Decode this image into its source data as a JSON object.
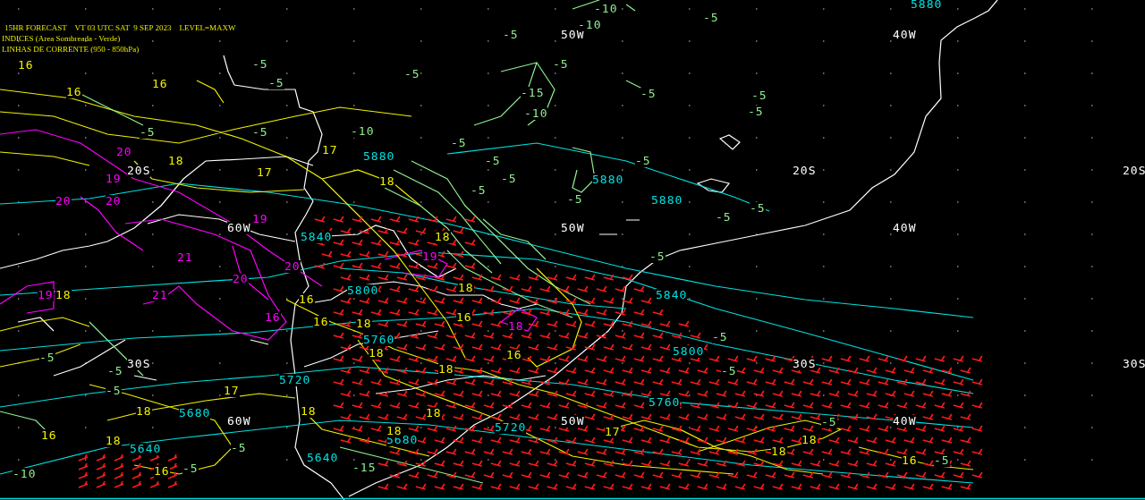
{
  "header": {
    "lines": [
      "15HR FORECAST    VT 03 UTC SAT  9 SEP 2023    LEVEL=MAXW",
      "INDICES (Area Sombreada - Verde)",
      "LINHAS DE CORRENTE (950 - 850hPa)"
    ]
  },
  "map": {
    "labels": [
      {
        "text": "50W",
        "kind": "grid"
      },
      {
        "text": "40W",
        "kind": "grid"
      },
      {
        "text": "20S",
        "kind": "grid"
      },
      {
        "text": "20S",
        "kind": "grid"
      },
      {
        "text": "20S",
        "kind": "grid"
      },
      {
        "text": "60W",
        "kind": "grid"
      },
      {
        "text": "50W",
        "kind": "grid"
      },
      {
        "text": "40W",
        "kind": "grid"
      },
      {
        "text": "30S",
        "kind": "grid"
      },
      {
        "text": "30S",
        "kind": "grid"
      },
      {
        "text": "30S",
        "kind": "grid"
      },
      {
        "text": "60W",
        "kind": "grid"
      },
      {
        "text": "50W",
        "kind": "grid"
      },
      {
        "text": "40W",
        "kind": "grid"
      },
      {
        "text": "5880",
        "kind": "height"
      },
      {
        "text": "5880",
        "kind": "height"
      },
      {
        "text": "5880",
        "kind": "height"
      },
      {
        "text": "5880",
        "kind": "height"
      },
      {
        "text": "5840",
        "kind": "height"
      },
      {
        "text": "5840",
        "kind": "height"
      },
      {
        "text": "5800",
        "kind": "height"
      },
      {
        "text": "5800",
        "kind": "height"
      },
      {
        "text": "5760",
        "kind": "height"
      },
      {
        "text": "5760",
        "kind": "height"
      },
      {
        "text": "5720",
        "kind": "height"
      },
      {
        "text": "5720",
        "kind": "height"
      },
      {
        "text": "5680",
        "kind": "height"
      },
      {
        "text": "5680",
        "kind": "height"
      },
      {
        "text": "5640",
        "kind": "height"
      },
      {
        "text": "5640",
        "kind": "height"
      },
      {
        "text": "20",
        "kind": "index"
      },
      {
        "text": "19",
        "kind": "index"
      },
      {
        "text": "19",
        "kind": "index"
      },
      {
        "text": "20",
        "kind": "index"
      },
      {
        "text": "20",
        "kind": "index"
      },
      {
        "text": "21",
        "kind": "index"
      },
      {
        "text": "20",
        "kind": "index"
      },
      {
        "text": "21",
        "kind": "index"
      },
      {
        "text": "20",
        "kind": "index"
      },
      {
        "text": "19",
        "kind": "index"
      },
      {
        "text": "16",
        "kind": "index"
      },
      {
        "text": "18",
        "kind": "index"
      },
      {
        "text": "19",
        "kind": "index"
      },
      {
        "text": "16",
        "kind": "temp"
      },
      {
        "text": "16",
        "kind": "temp"
      },
      {
        "text": "16",
        "kind": "temp"
      },
      {
        "text": "18",
        "kind": "temp"
      },
      {
        "text": "17",
        "kind": "temp"
      },
      {
        "text": "17",
        "kind": "temp"
      },
      {
        "text": "18",
        "kind": "temp"
      },
      {
        "text": "18",
        "kind": "temp"
      },
      {
        "text": "18",
        "kind": "temp"
      },
      {
        "text": "16",
        "kind": "temp"
      },
      {
        "text": "16",
        "kind": "temp"
      },
      {
        "text": "18",
        "kind": "temp"
      },
      {
        "text": "18",
        "kind": "temp"
      },
      {
        "text": "18",
        "kind": "temp"
      },
      {
        "text": "16",
        "kind": "temp"
      },
      {
        "text": "18",
        "kind": "temp"
      },
      {
        "text": "16",
        "kind": "temp"
      },
      {
        "text": "17",
        "kind": "temp"
      },
      {
        "text": "18",
        "kind": "temp"
      },
      {
        "text": "18",
        "kind": "temp"
      },
      {
        "text": "16",
        "kind": "temp"
      },
      {
        "text": "16",
        "kind": "temp"
      },
      {
        "text": "18",
        "kind": "temp"
      },
      {
        "text": "18",
        "kind": "temp"
      },
      {
        "text": "17",
        "kind": "temp"
      },
      {
        "text": "18",
        "kind": "temp"
      },
      {
        "text": "18",
        "kind": "temp"
      },
      {
        "text": "16",
        "kind": "temp"
      },
      {
        "text": "18",
        "kind": "temp"
      },
      {
        "text": "-5",
        "kind": "lifted"
      },
      {
        "text": "-5",
        "kind": "lifted"
      },
      {
        "text": "-5",
        "kind": "lifted"
      },
      {
        "text": "-5",
        "kind": "lifted"
      },
      {
        "text": "-5",
        "kind": "lifted"
      },
      {
        "text": "-5",
        "kind": "lifted"
      },
      {
        "text": "-5",
        "kind": "lifted"
      },
      {
        "text": "-5",
        "kind": "lifted"
      },
      {
        "text": "-5",
        "kind": "lifted"
      },
      {
        "text": "-5",
        "kind": "lifted"
      },
      {
        "text": "-5",
        "kind": "lifted"
      },
      {
        "text": "-5",
        "kind": "lifted"
      },
      {
        "text": "-5",
        "kind": "lifted"
      },
      {
        "text": "-5",
        "kind": "lifted"
      },
      {
        "text": "-5",
        "kind": "lifted"
      },
      {
        "text": "-5",
        "kind": "lifted"
      },
      {
        "text": "-5",
        "kind": "lifted"
      },
      {
        "text": "-5",
        "kind": "lifted"
      },
      {
        "text": "-5",
        "kind": "lifted"
      },
      {
        "text": "-5",
        "kind": "lifted"
      },
      {
        "text": "-5",
        "kind": "lifted"
      },
      {
        "text": "-5",
        "kind": "lifted"
      },
      {
        "text": "-5",
        "kind": "lifted"
      },
      {
        "text": "-5",
        "kind": "lifted"
      },
      {
        "text": "-5",
        "kind": "lifted"
      },
      {
        "text": "-5",
        "kind": "lifted"
      },
      {
        "text": "-5",
        "kind": "lifted"
      },
      {
        "text": "-5",
        "kind": "lifted"
      },
      {
        "text": "-5",
        "kind": "lifted"
      },
      {
        "text": "-10",
        "kind": "lifted"
      },
      {
        "text": "-10",
        "kind": "lifted"
      },
      {
        "text": "-10",
        "kind": "lifted"
      },
      {
        "text": "-15",
        "kind": "lifted"
      },
      {
        "text": "-10",
        "kind": "lifted"
      },
      {
        "text": "-10",
        "kind": "lifted"
      },
      {
        "text": "-15",
        "kind": "lifted"
      }
    ]
  }
}
